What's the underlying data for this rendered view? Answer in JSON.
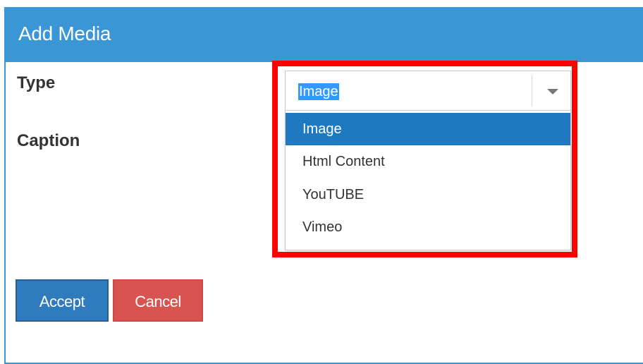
{
  "dialog": {
    "title": "Add Media"
  },
  "form": {
    "type_label": "Type",
    "caption_label": "Caption"
  },
  "type_select": {
    "selected_value": "Image",
    "options": [
      {
        "label": "Image",
        "selected": true
      },
      {
        "label": "Html Content",
        "selected": false
      },
      {
        "label": "YouTUBE",
        "selected": false
      },
      {
        "label": "Vimeo",
        "selected": false
      }
    ]
  },
  "buttons": {
    "accept_label": "Accept",
    "cancel_label": "Cancel"
  },
  "icons": {
    "dropdown_arrow": "chevron-down-icon"
  },
  "colors": {
    "header": "#3a96d4",
    "selected_option": "#1f79c0",
    "accept": "#2f7bbd",
    "cancel": "#d9534f",
    "highlight": "#ff0000"
  }
}
